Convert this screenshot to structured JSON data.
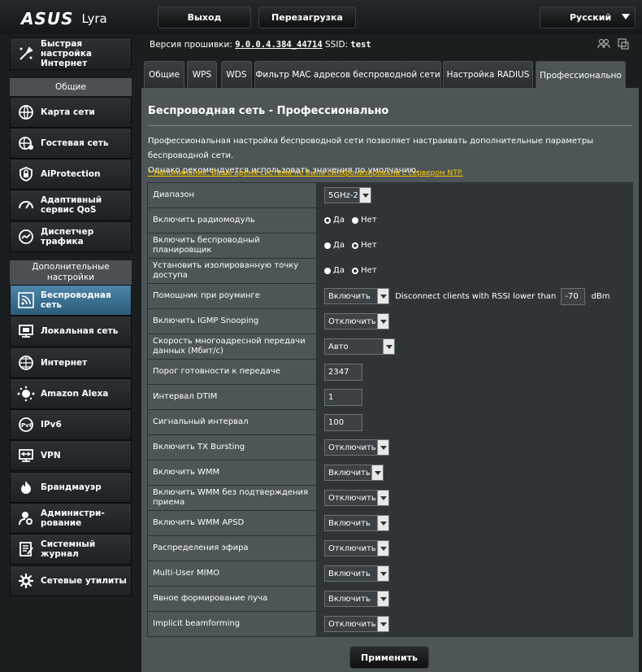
{
  "header": {
    "brand": "ASUS",
    "model": "Lyra",
    "logout_label": "Выход",
    "reboot_label": "Перезагрузка",
    "language": "Русский"
  },
  "status": {
    "fw_label": "Версия прошивки:",
    "fw_value": "9.0.0.4.384_44714",
    "ssid_label": "SSID:",
    "ssid_value": "test"
  },
  "sidebar": {
    "quick_setup": "Быстрая настройка Интернет",
    "general_header": "Общие",
    "general_items": [
      {
        "label": "Карта сети",
        "icon": "network-map-icon"
      },
      {
        "label": "Гостевая сеть",
        "icon": "guest-network-icon"
      },
      {
        "label": "AiProtection",
        "icon": "aiprotection-icon"
      },
      {
        "label": "Адаптивный сервис QoS",
        "icon": "qos-icon"
      },
      {
        "label": "Диспетчер трафика",
        "icon": "traffic-analyzer-icon"
      }
    ],
    "advanced_header": "Дополнительные настройки",
    "advanced_items": [
      {
        "label": "Беспроводная сеть",
        "icon": "wireless-icon",
        "active": true
      },
      {
        "label": "Локальная сеть",
        "icon": "lan-icon"
      },
      {
        "label": "Интернет",
        "icon": "wan-icon"
      },
      {
        "label": "Amazon Alexa",
        "icon": "alexa-icon"
      },
      {
        "label": "IPv6",
        "icon": "ipv6-icon"
      },
      {
        "label": "VPN",
        "icon": "vpn-icon"
      },
      {
        "label": "Брандмауэр",
        "icon": "firewall-icon"
      },
      {
        "label": "Администри-рование",
        "icon": "administration-icon"
      },
      {
        "label": "Системный журнал",
        "icon": "system-log-icon"
      },
      {
        "label": "Сетевые утилиты",
        "icon": "network-tools-icon"
      }
    ]
  },
  "tabs": [
    {
      "label": "Общие"
    },
    {
      "label": "WPS"
    },
    {
      "label": "WDS"
    },
    {
      "label": "Фильтр MAC адресов беспроводной сети"
    },
    {
      "label": "Настройка RADIUS"
    },
    {
      "label": "Профессионально",
      "active": true
    }
  ],
  "panel": {
    "title": "Беспроводная сеть - Профессионально",
    "desc1": "Профессиональная настройка беспроводной сети позволяет настраивать дополнительные параметры беспроводной сети.",
    "desc2": "Однако рекомендуется использовать значения по умолчанию.",
    "warning": "* Напоминание: Ваше время система не была синхронизирована с сервером NTP."
  },
  "settings": {
    "band": {
      "label": "Диапазон",
      "value": "5GHz-2"
    },
    "radio": {
      "label": "Включить радиомодуль",
      "yes": "Да",
      "no": "Нет",
      "selected": "no"
    },
    "scheduler": {
      "label": "Включить беспроводный планировщик",
      "yes": "Да",
      "no": "Нет",
      "selected": "yes"
    },
    "isolation": {
      "label": "Установить изолированную точку доступа",
      "yes": "Да",
      "no": "Нет",
      "selected": "yes"
    },
    "roaming": {
      "label": "Помощник при роуминге",
      "value": "Включить",
      "text": "Disconnect clients with RSSI lower than",
      "rssi": "-70",
      "unit": "dBm"
    },
    "igmp": {
      "label": "Включить IGMP Snooping",
      "value": "Отключить"
    },
    "multicast": {
      "label": "Скорость многоадресной передачи данных (Мбит/с)",
      "value": "Авто"
    },
    "rts": {
      "label": "Порог готовности к передаче",
      "value": "2347"
    },
    "dtim": {
      "label": "Интервал DTIM",
      "value": "1"
    },
    "beacon": {
      "label": "Сигнальный интервал",
      "value": "100"
    },
    "txburst": {
      "label": "Включить TX Bursting",
      "value": "Отключить"
    },
    "wmm": {
      "label": "Включить WMM",
      "value": "Включить"
    },
    "wmm_noack": {
      "label": "Включить WMM без подтверждения приема",
      "value": "Отключить"
    },
    "wmm_apsd": {
      "label": "Включить WMM APSD",
      "value": "Включить"
    },
    "airtime": {
      "label": "Распределения эфира",
      "value": "Отключить"
    },
    "mumimo": {
      "label": "Multi-User MIMO",
      "value": "Включить"
    },
    "explicit_bf": {
      "label": "Явное формирование пуча",
      "value": "Включить"
    },
    "implicit_bf": {
      "label": "Implicit beamforming",
      "value": "Отключить"
    }
  },
  "apply_label": "Применить",
  "colors": {
    "background": "#1b1e1f",
    "panel": "#4d5558",
    "active_sidebar": "#3f7aa0",
    "warning": "#ffcc00"
  }
}
